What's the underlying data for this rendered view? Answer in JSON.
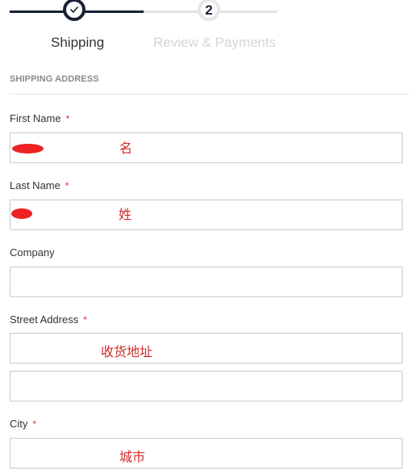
{
  "stepper": {
    "steps": [
      {
        "label": "Shipping",
        "state": "complete"
      },
      {
        "label": "Review & Payments",
        "number": "2",
        "state": "upcoming"
      }
    ],
    "active_color": "#1a2137",
    "inactive_color": "#e3e3e3"
  },
  "section": {
    "title": "SHIPPING ADDRESS"
  },
  "fields": {
    "first_name": {
      "label": "First Name",
      "required_mark": "*",
      "annotation": "名"
    },
    "last_name": {
      "label": "Last Name",
      "required_mark": "*",
      "annotation": "姓"
    },
    "company": {
      "label": "Company"
    },
    "street": {
      "label": "Street Address",
      "required_mark": "*",
      "annotation": "收货地址"
    },
    "city": {
      "label": "City",
      "required_mark": "*",
      "annotation": "城市"
    }
  },
  "colors": {
    "required": "#e02b27",
    "annotation": "#d22a2a",
    "input_border": "#c9c9c9"
  }
}
